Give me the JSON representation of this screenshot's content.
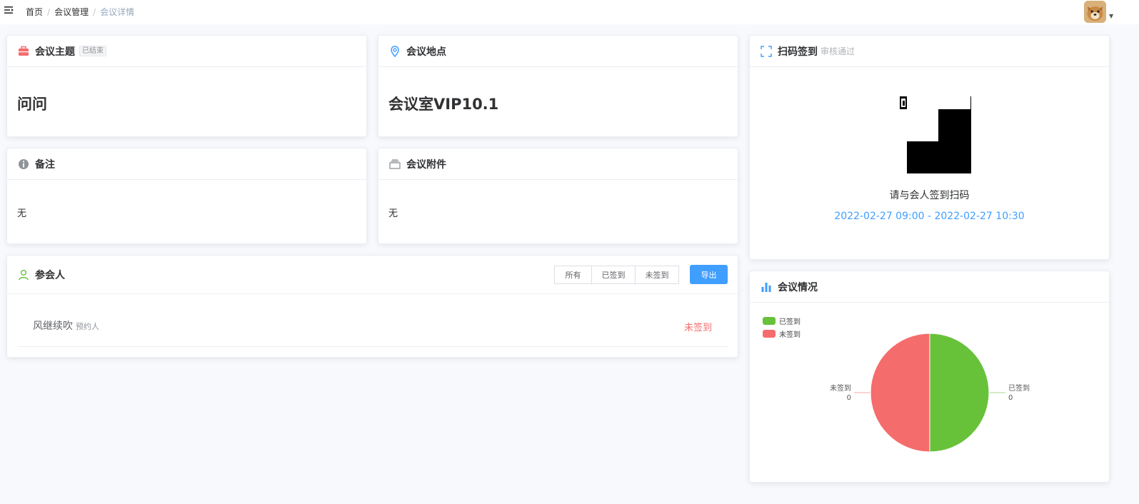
{
  "breadcrumb": {
    "home": "首页",
    "section": "会议管理",
    "current": "会议详情"
  },
  "cards": {
    "topic": {
      "title": "会议主题",
      "tag": "已结束",
      "value": "问问"
    },
    "location": {
      "title": "会议地点",
      "value": "会议室VIP10.1"
    },
    "remark": {
      "title": "备注",
      "value": "无"
    },
    "attachment": {
      "title": "会议附件",
      "value": "无"
    },
    "attendees": {
      "title": "参会人",
      "filters": [
        "所有",
        "已签到",
        "未签到"
      ],
      "export_label": "导出",
      "rows": [
        {
          "name": "风继续吹",
          "role": "预约人",
          "status": "未签到"
        }
      ]
    },
    "checkin": {
      "title": "扫码签到",
      "note": "审核通过",
      "hint": "请与会人签到扫码",
      "time": "2022-02-27 09:00 - 2022-02-27 10:30"
    },
    "stats": {
      "title": "会议情况"
    }
  },
  "colors": {
    "accent": "#409eff",
    "signed": "#67c23a",
    "unsigned": "#f56c6c",
    "danger_text": "#f56c6c"
  },
  "chart_data": {
    "type": "pie",
    "title": "",
    "legend": [
      "已签到",
      "未签到"
    ],
    "legend_position": "top-left",
    "slices": [
      {
        "name": "已签到",
        "value": 0,
        "color": "#67c23a"
      },
      {
        "name": "未签到",
        "value": 0,
        "color": "#f56c6c"
      }
    ]
  }
}
